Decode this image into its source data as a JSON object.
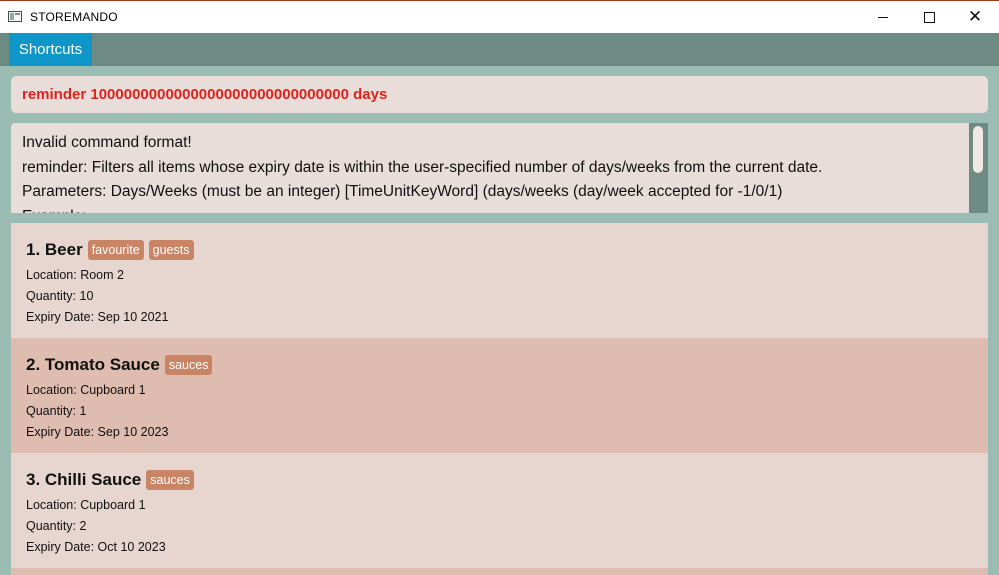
{
  "window": {
    "title": "STOREMANDO"
  },
  "menubar": {
    "items": [
      "Shortcuts"
    ]
  },
  "command": {
    "text": "reminder 1000000000000000000000000000000 days"
  },
  "result": {
    "lines": [
      "Invalid command format!",
      "reminder: Filters all items whose expiry date is within the user-specified number of days/weeks from the current date.",
      "Parameters: Days/Weeks (must be an integer) [TimeUnitKeyWord] (days/weeks (day/week accepted for -1/0/1)",
      "Example:"
    ]
  },
  "items": [
    {
      "name": "1. Beer",
      "tags": [
        "favourite",
        "guests"
      ],
      "location": "Location: Room 2",
      "quantity": "Quantity: 10",
      "expiry": "Expiry Date: Sep 10 2021"
    },
    {
      "name": "2. Tomato Sauce",
      "tags": [
        "sauces"
      ],
      "location": "Location: Cupboard 1",
      "quantity": "Quantity: 1",
      "expiry": "Expiry Date: Sep 10 2023"
    },
    {
      "name": "3. Chilli Sauce",
      "tags": [
        "sauces"
      ],
      "location": "Location: Cupboard 1",
      "quantity": "Quantity: 2",
      "expiry": "Expiry Date: Oct 10 2023"
    }
  ],
  "colors": {
    "menu_accent": "#0f96c8",
    "command_text": "#e0221e",
    "tag": "#c98466"
  }
}
